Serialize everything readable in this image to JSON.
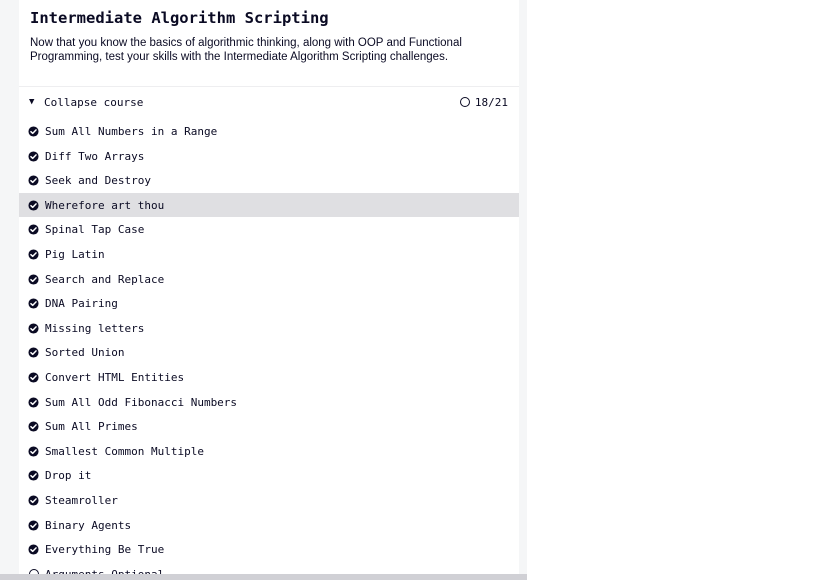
{
  "course": {
    "title": "Intermediate Algorithm Scripting",
    "description": "Now that you know the basics of algorithmic thinking, along with OOP and Functional Programming, test your skills with the Intermediate Algorithm Scripting challenges.",
    "collapse_arrow": "▼",
    "collapse_label": "Collapse course",
    "progress": "18/21"
  },
  "challenges": [
    {
      "label": "Sum All Numbers in a Range",
      "completed": true
    },
    {
      "label": "Diff Two Arrays",
      "completed": true
    },
    {
      "label": "Seek and Destroy",
      "completed": true
    },
    {
      "label": "Wherefore art thou",
      "completed": true,
      "highlighted": true
    },
    {
      "label": "Spinal Tap Case",
      "completed": true
    },
    {
      "label": "Pig Latin",
      "completed": true
    },
    {
      "label": "Search and Replace",
      "completed": true
    },
    {
      "label": "DNA Pairing",
      "completed": true
    },
    {
      "label": "Missing letters",
      "completed": true
    },
    {
      "label": "Sorted Union",
      "completed": true
    },
    {
      "label": "Convert HTML Entities",
      "completed": true
    },
    {
      "label": "Sum All Odd Fibonacci Numbers",
      "completed": true
    },
    {
      "label": "Sum All Primes",
      "completed": true
    },
    {
      "label": "Smallest Common Multiple",
      "completed": true
    },
    {
      "label": "Drop it",
      "completed": true
    },
    {
      "label": "Steamroller",
      "completed": true
    },
    {
      "label": "Binary Agents",
      "completed": true
    },
    {
      "label": "Everything Be True",
      "completed": true
    },
    {
      "label": "Arguments Optional",
      "completed": false
    }
  ],
  "icons": {
    "completed": "check-circle-icon",
    "incomplete": "circle-outline-icon"
  },
  "colors": {
    "text": "#0a0a23",
    "highlight": "#dfdfe2",
    "gutter": "#f5f6f7"
  }
}
